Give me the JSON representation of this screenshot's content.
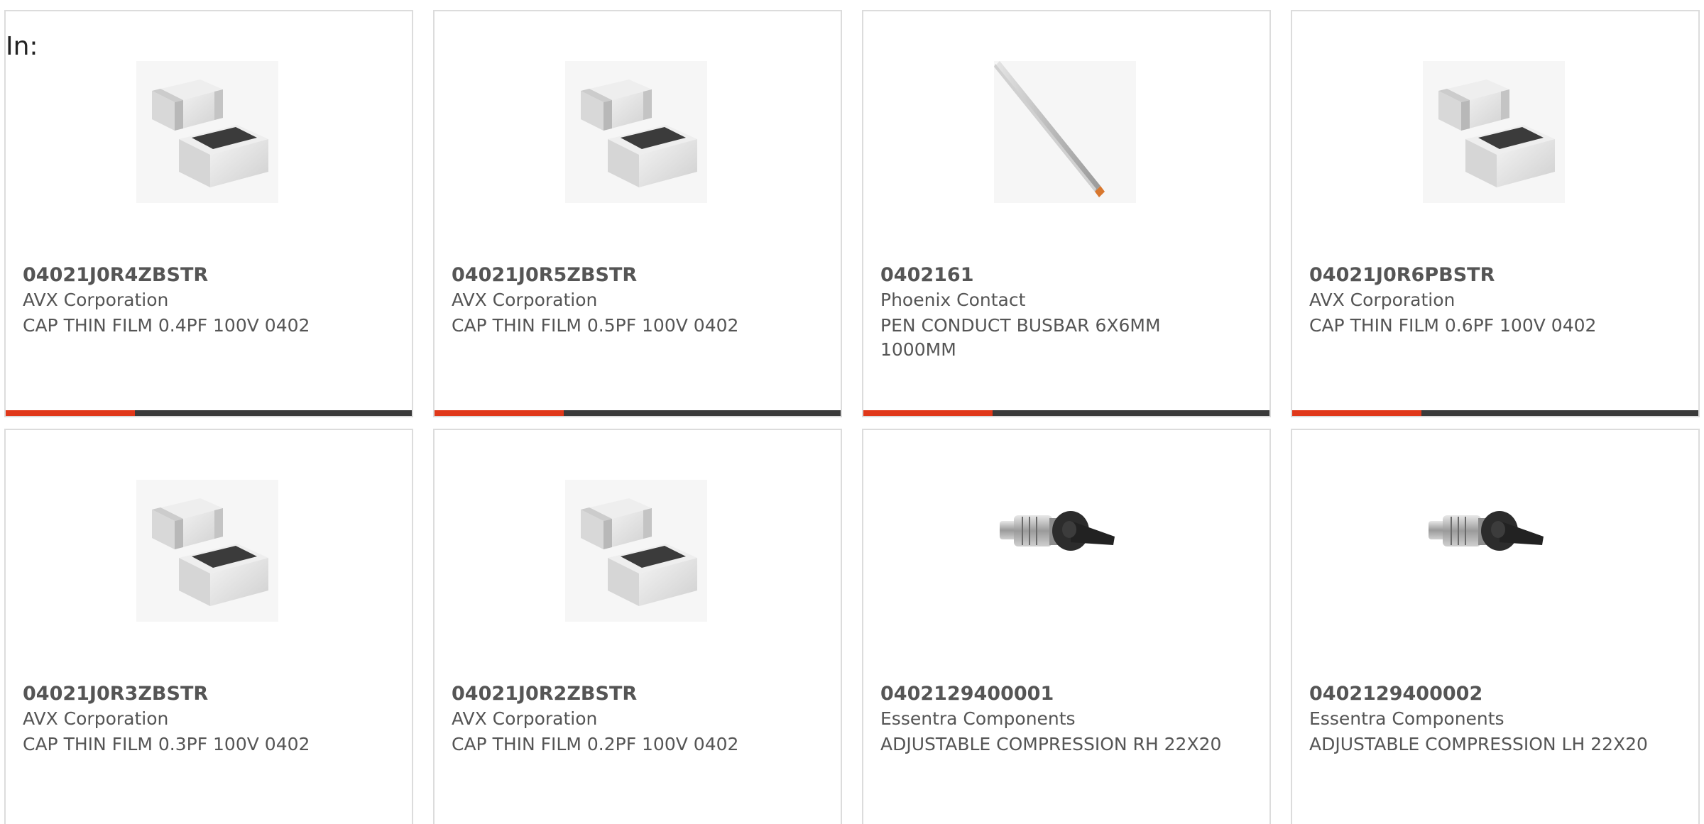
{
  "filter": {
    "in_label": "In:"
  },
  "colors": {
    "accent": "#e0381a",
    "bar_dark": "#3a3a3a",
    "text": "#555555",
    "border": "#dcdcdc"
  },
  "products": [
    {
      "part_number": "04021J0R4ZBSTR",
      "manufacturer": "AVX Corporation",
      "description": "CAP THIN FILM 0.4PF 100V 0402",
      "image_icon": "smd-capacitor-image"
    },
    {
      "part_number": "04021J0R5ZBSTR",
      "manufacturer": "AVX Corporation",
      "description": "CAP THIN FILM 0.5PF 100V 0402",
      "image_icon": "smd-capacitor-image"
    },
    {
      "part_number": "0402161",
      "manufacturer": "Phoenix Contact",
      "description": "PEN CONDUCT BUSBAR 6X6MM 1000MM",
      "image_icon": "busbar-image"
    },
    {
      "part_number": "04021J0R6PBSTR",
      "manufacturer": "AVX Corporation",
      "description": "CAP THIN FILM 0.6PF 100V 0402",
      "image_icon": "smd-capacitor-image"
    },
    {
      "part_number": "04021J0R3ZBSTR",
      "manufacturer": "AVX Corporation",
      "description": "CAP THIN FILM 0.3PF 100V 0402",
      "image_icon": "smd-capacitor-image"
    },
    {
      "part_number": "04021J0R2ZBSTR",
      "manufacturer": "AVX Corporation",
      "description": "CAP THIN FILM 0.2PF 100V 0402",
      "image_icon": "smd-capacitor-image"
    },
    {
      "part_number": "0402129400001",
      "manufacturer": "Essentra Components",
      "description": "ADJUSTABLE COMPRESSION RH 22X20",
      "image_icon": "compression-latch-image"
    },
    {
      "part_number": "0402129400002",
      "manufacturer": "Essentra Components",
      "description": "ADJUSTABLE COMPRESSION LH 22X20",
      "image_icon": "compression-latch-image"
    }
  ]
}
